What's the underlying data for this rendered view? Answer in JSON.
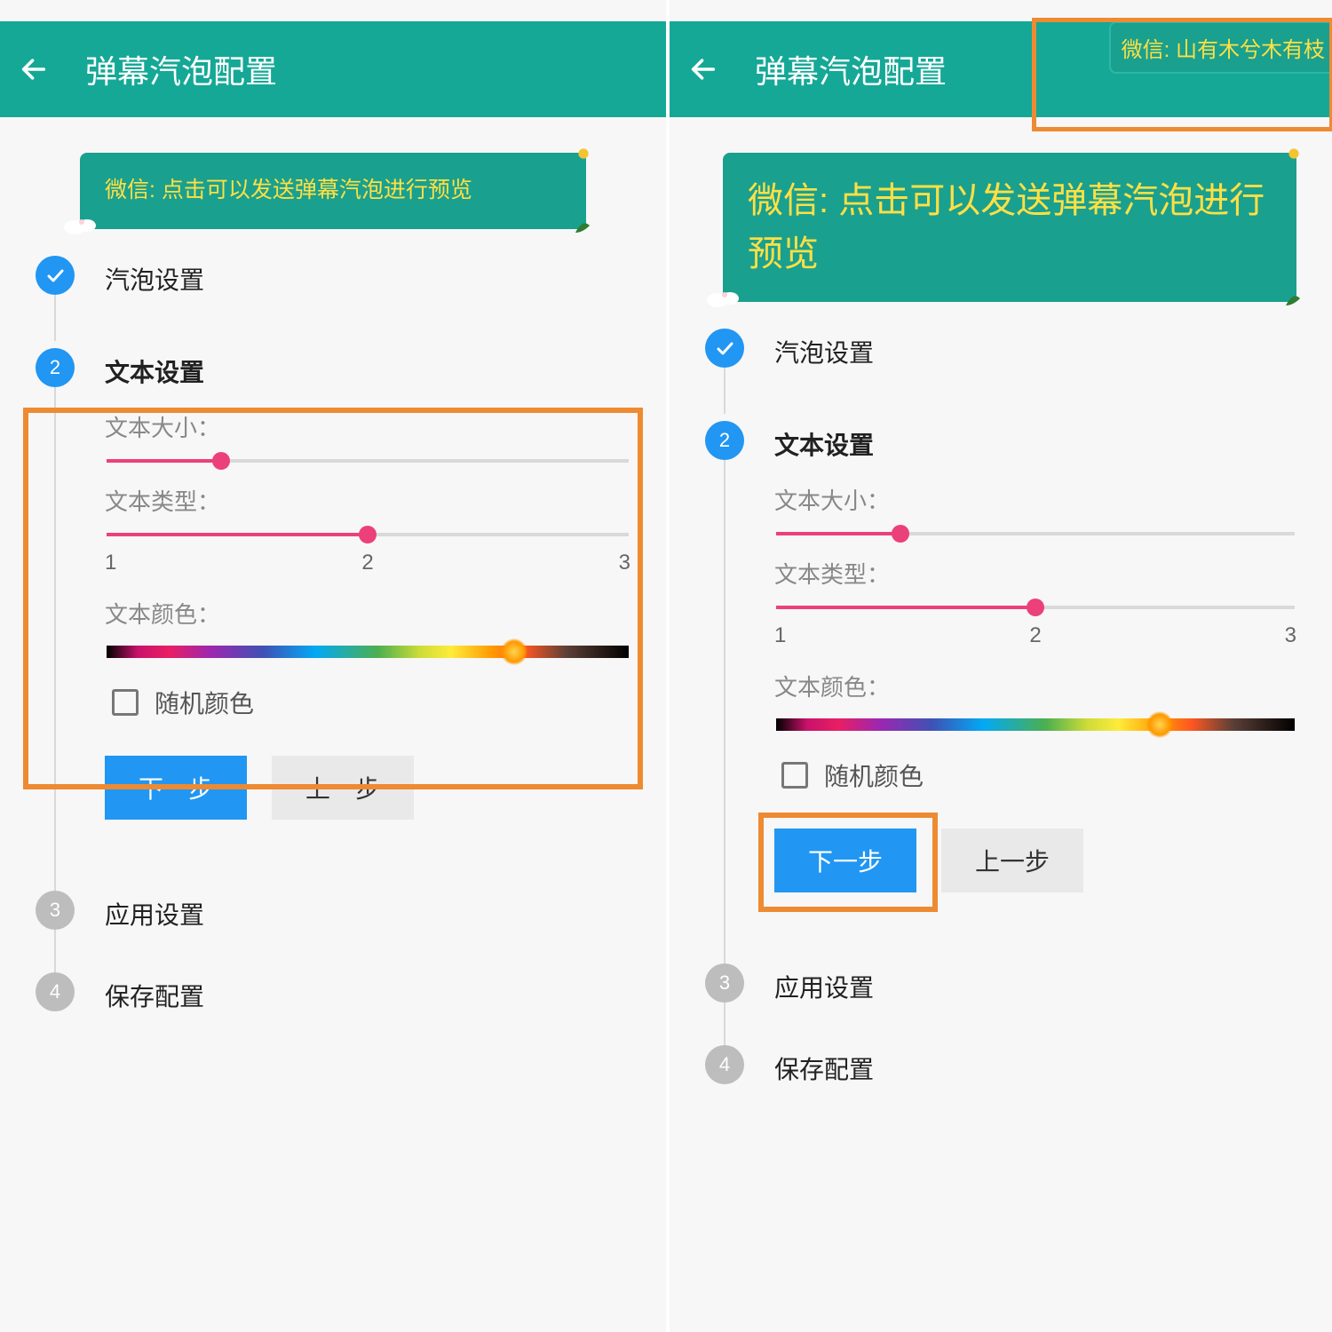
{
  "header": {
    "title": "弹幕汽泡配置"
  },
  "notif": {
    "text": "微信: 山有木兮木有枝"
  },
  "preview": {
    "text": "微信: 点击可以发送弹幕汽泡进行预览"
  },
  "steps": {
    "s1": {
      "label": "汽泡设置"
    },
    "s2": {
      "label": "文本设置"
    },
    "s3": {
      "number": "3",
      "label": "应用设置"
    },
    "s4": {
      "number": "4",
      "label": "保存配置"
    },
    "active_number": "2"
  },
  "fields": {
    "size_label": "文本大小：",
    "type_label": "文本类型：",
    "color_label": "文本颜色：",
    "type_ticks": {
      "a": "1",
      "b": "2",
      "c": "3"
    },
    "random_color_label": "随机颜色"
  },
  "sliders": {
    "left": {
      "size_pct": 22,
      "type_pct": 50,
      "color_pct": 78
    },
    "right": {
      "size_pct": 24,
      "type_pct": 50,
      "color_pct": 74
    }
  },
  "buttons": {
    "next": "下一步",
    "prev": "上一步"
  }
}
